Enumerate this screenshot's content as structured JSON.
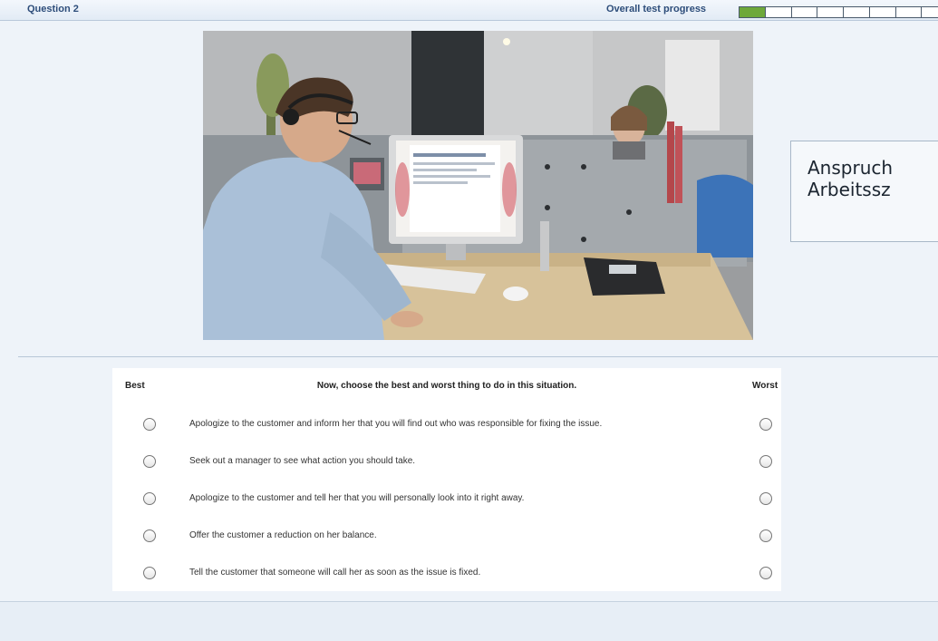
{
  "header": {
    "question_label": "Question 2",
    "progress_label": "Overall test progress",
    "progress": {
      "segments_total": 8,
      "segments_completed": 1
    },
    "colors": {
      "progress_fill": "#6ea83a",
      "label": "#2d4d7a"
    }
  },
  "scene": {
    "description_icon": "office-call-center-photo"
  },
  "callout": {
    "text": "Anspruch\nArbeitssz"
  },
  "question": {
    "best_header": "Best",
    "prompt": "Now, choose the best and worst thing to do in this situation.",
    "worst_header": "Worst",
    "options": [
      {
        "text": "Apologize to the customer and inform her that you will find out who was responsible for fixing the issue."
      },
      {
        "text": "Seek out a manager to see what action you should take."
      },
      {
        "text": "Apologize to the customer and tell her that you will personally look into it right away."
      },
      {
        "text": "Offer the customer a reduction on her balance."
      },
      {
        "text": "Tell the customer that someone will call her as soon as the issue is fixed."
      }
    ]
  }
}
